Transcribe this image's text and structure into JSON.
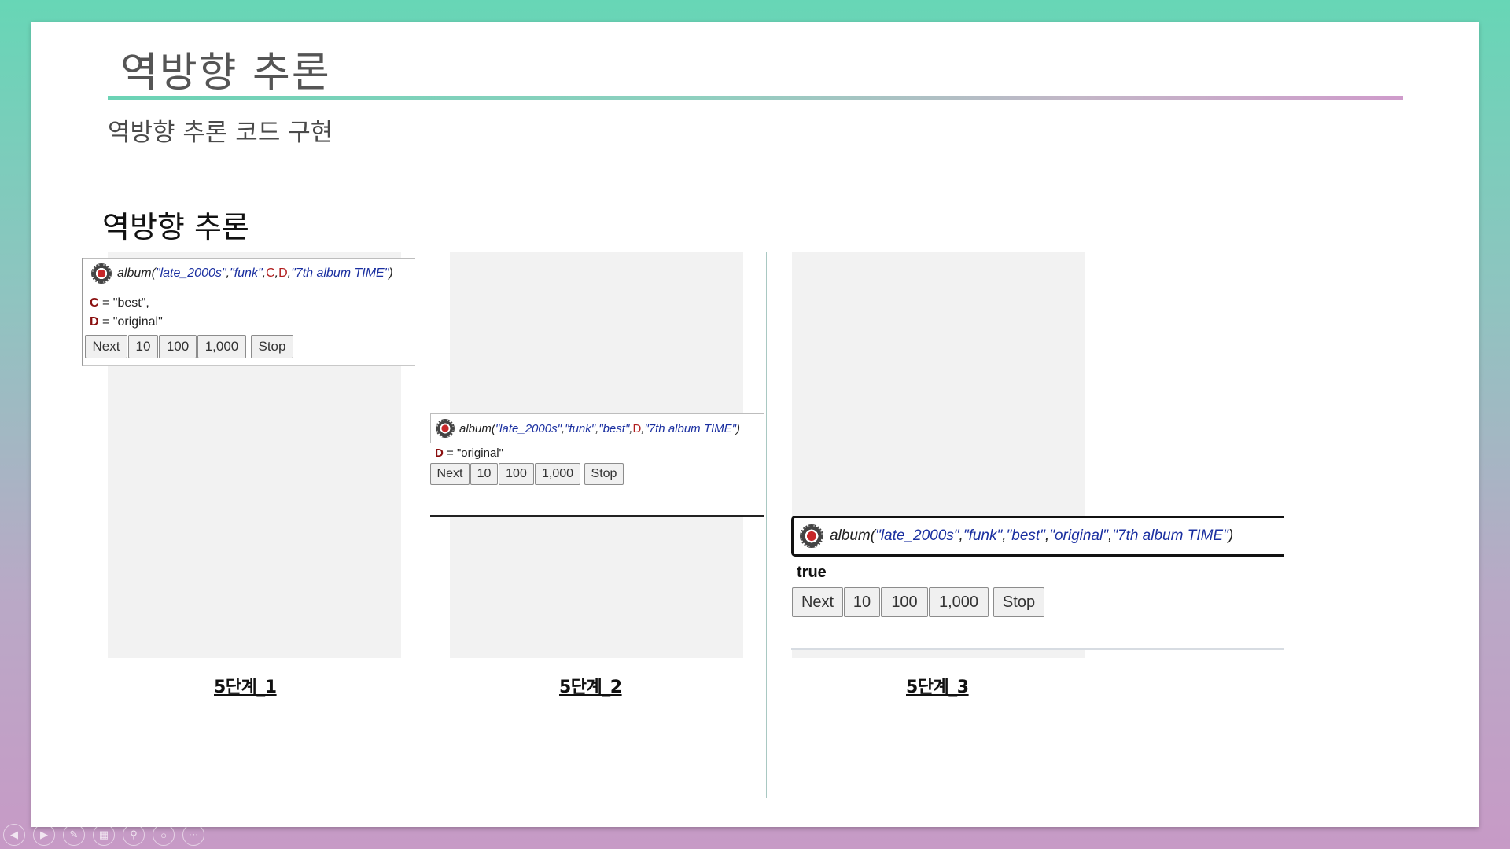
{
  "slide": {
    "title": "역방향 추론",
    "subtitle": "역방향 추론 코드 구현",
    "section_heading": "역방향 추론"
  },
  "panels": [
    {
      "query": {
        "pred": "album(",
        "parts": [
          "\"late_2000s\"",
          ",",
          "\"funk\"",
          ",",
          "C",
          ",",
          "D",
          ",",
          "\"7th album TIME\"",
          ")"
        ]
      },
      "answers": [
        {
          "var": "C",
          "rest": " = \"best\","
        },
        {
          "var": "D",
          "rest": " = \"original\""
        }
      ],
      "buttons": [
        "Next",
        "10",
        "100",
        "1,000",
        "Stop"
      ],
      "label": "5단계_1"
    },
    {
      "query": {
        "pred": "album(",
        "parts": [
          "\"late_2000s\"",
          ",",
          "\"funk\"",
          ",",
          "\"best\"",
          ",",
          "D",
          ",",
          "\"7th album TIME\"",
          ")"
        ]
      },
      "answers": [
        {
          "var": "D",
          "rest": " = \"original\""
        }
      ],
      "buttons": [
        "Next",
        "10",
        "100",
        "1,000",
        "Stop"
      ],
      "label": "5단계_2"
    },
    {
      "query": {
        "pred": "album(",
        "parts": [
          "\"late_2000s\"",
          ",",
          "\"funk\"",
          ",",
          "\"best\"",
          ",",
          "\"original\"",
          ",",
          "\"7th album TIME\"",
          ")"
        ]
      },
      "result": "true",
      "buttons": [
        "Next",
        "10",
        "100",
        "1,000",
        "Stop"
      ],
      "label": "5단계_3"
    }
  ],
  "icons": {
    "query_icon": "gear-icon",
    "controls": [
      "prev-icon",
      "next-icon",
      "pen-icon",
      "slides-icon",
      "zoom-icon",
      "pointer-icon",
      "more-icon"
    ]
  },
  "colors": {
    "string": "#1a2fa0",
    "variable": "#b01c1c",
    "answer_variable": "#8a0f0f"
  }
}
